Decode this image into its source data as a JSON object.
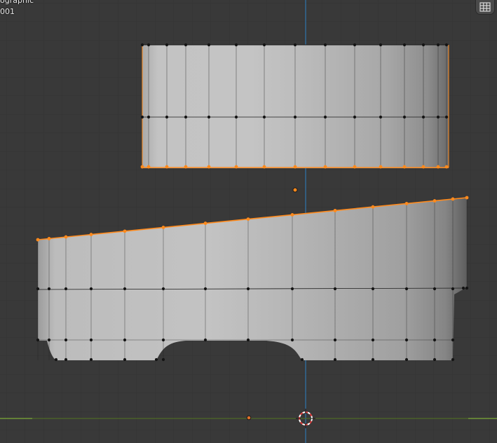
{
  "viewport": {
    "view_mode_label": "ographic",
    "object_name_label": "001",
    "grid_toggle_icon": "grid-icon"
  },
  "colors": {
    "background": "#393939",
    "grid_minor": "#323232",
    "grid_major": "#2c2c2c",
    "axis_vertical": "#2f6fa3",
    "axis_horizontal": "#5c7a2a",
    "selection": "#ff8a1c",
    "vertex": "#141414",
    "wire": "#1c1c1c",
    "cursor_red": "#e03c3c"
  }
}
